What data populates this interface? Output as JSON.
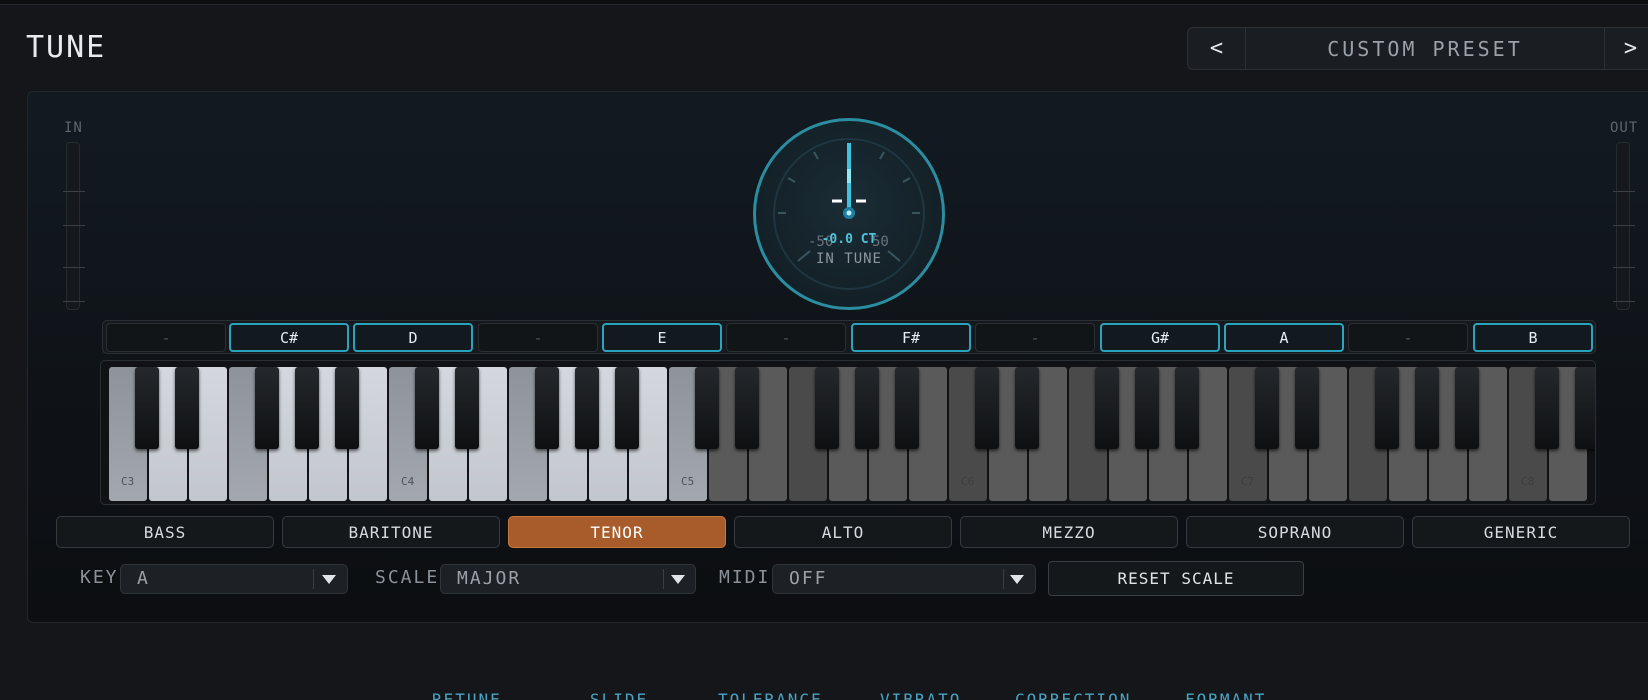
{
  "title": "TUNE",
  "preset": {
    "prev_icon": "chevron-left-icon",
    "name": "CUSTOM PRESET",
    "next_icon": "chevron-right-icon"
  },
  "meters": {
    "in_label": "IN",
    "out_label": "OUT"
  },
  "tuner": {
    "cents": "-0.0 CT",
    "status": "IN TUNE",
    "range_min": "-50",
    "range_max": "50"
  },
  "scale_notes": [
    "-",
    "C#",
    "D",
    "-",
    "E",
    "-",
    "F#",
    "-",
    "G#",
    "A",
    "-",
    "B"
  ],
  "keyboard_labels": [
    "C3",
    "C4",
    "C5",
    "C6",
    "C7",
    "C8"
  ],
  "voices": [
    {
      "label": "BASS",
      "active": false
    },
    {
      "label": "BARITONE",
      "active": false
    },
    {
      "label": "TENOR",
      "active": true
    },
    {
      "label": "ALTO",
      "active": false
    },
    {
      "label": "MEZZO",
      "active": false
    },
    {
      "label": "SOPRANO",
      "active": false
    },
    {
      "label": "GENERIC",
      "active": false
    }
  ],
  "controls": {
    "key_label": "KEY",
    "key_value": "A",
    "scale_label": "SCALE",
    "scale_value": "MAJOR",
    "midi_label": "MIDI",
    "midi_value": "OFF",
    "reset_label": "RESET SCALE"
  },
  "tabs": [
    "RETUNE",
    "SLIDE",
    "TOLERANCE",
    "VIBRATO",
    "CORRECTION",
    "FORMANT"
  ],
  "colors": {
    "accent": "#2aa4bd",
    "active_voice": "#a95c2b"
  }
}
